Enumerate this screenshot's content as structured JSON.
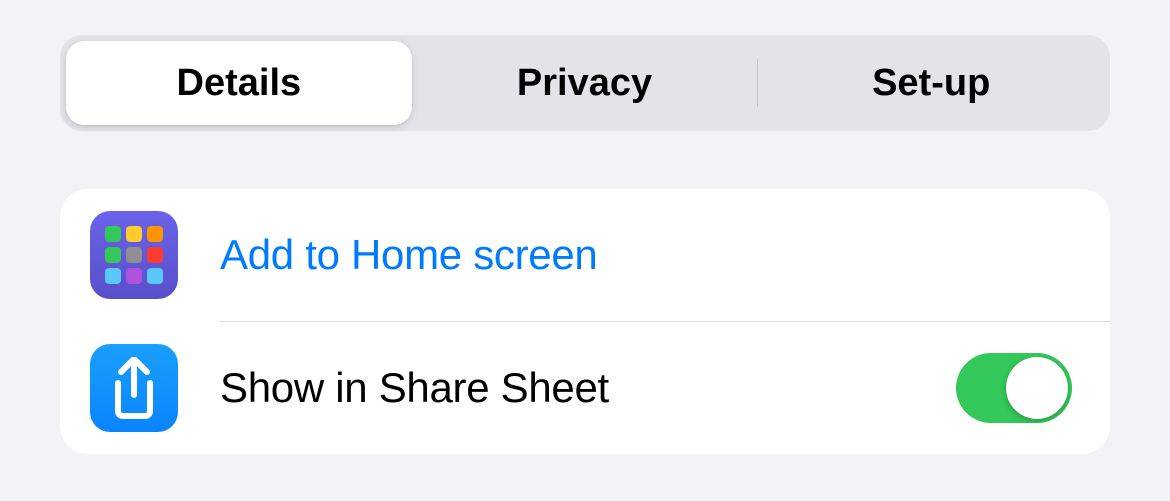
{
  "tabs": {
    "items": [
      {
        "label": "Details",
        "selected": true
      },
      {
        "label": "Privacy",
        "selected": false
      },
      {
        "label": "Set-up",
        "selected": false
      }
    ]
  },
  "list": {
    "addHome": {
      "label": "Add to Home screen",
      "iconName": "home-screen-icon"
    },
    "shareSheet": {
      "label": "Show in Share Sheet",
      "iconName": "share-icon",
      "toggle": true
    }
  },
  "colors": {
    "accent": "#007aff",
    "toggleOn": "#34c759",
    "homeIcon": "#5850c9",
    "shareIcon": "#0a84ff"
  },
  "gridColors": [
    "#34c759",
    "#ffcb2e",
    "#ff9500",
    "#34c759",
    "#8e8e93",
    "#ff3b30",
    "#5ac8fa",
    "#af52de",
    "#5ac8fa"
  ]
}
